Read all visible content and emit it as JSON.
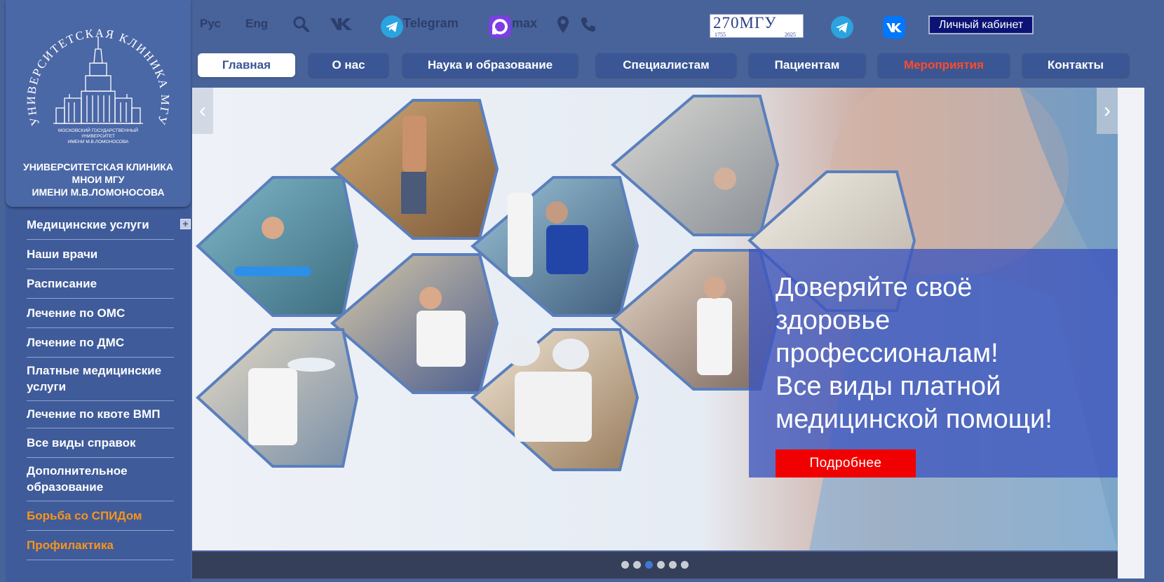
{
  "brand": {
    "logo_arc_text": "УНИВЕРСИТЕТСКАЯ КЛИНИКА МГУ",
    "logo_small_text": [
      "МОСКОВСКИЙ ГОСУДАРСТВЕННЫЙ",
      "УНИВЕРСИТЕТ",
      "ИМЕНИ М.В.ЛОМОНОСОВА"
    ],
    "name": "УНИВЕРСИТЕТСКАЯ КЛИНИКА\nМНОИ МГУ\nИМЕНИ М.В.ЛОМОНОСОВА"
  },
  "sidebar": {
    "items": [
      {
        "label": "Медицинские услуги",
        "expand": "+"
      },
      {
        "label": "Наши врачи"
      },
      {
        "label": "Расписание"
      },
      {
        "label": "Лечение по ОМС"
      },
      {
        "label": "Лечение по ДМС"
      },
      {
        "label": "Платные медицинские услуги"
      },
      {
        "label": "Лечение по квоте ВМП"
      },
      {
        "label": "Все виды справок"
      },
      {
        "label": "Дополнительное образование"
      },
      {
        "label": "Борьба со СПИДом"
      },
      {
        "label": "Профилактика"
      }
    ]
  },
  "topbar": {
    "lang_ru": "Рус",
    "lang_en": "Eng",
    "telegram_label": "Telegram",
    "max_label": "max",
    "badge": {
      "main": "270МГУ",
      "year_from": "1755",
      "year_to": "2025"
    },
    "cabinet_label": "Личный кабинет"
  },
  "nav": {
    "items": [
      {
        "label": "Главная"
      },
      {
        "label": "О нас"
      },
      {
        "label": "Наука и образование"
      },
      {
        "label": "Специалистам"
      },
      {
        "label": "Пациентам"
      },
      {
        "label": "Мероприятия"
      },
      {
        "label": "Контакты"
      }
    ]
  },
  "slider": {
    "prev_symbol": "‹",
    "next_symbol": "›",
    "headline": "Доверяйте своё\nздоровье\nпрофессионалам!\nВсе виды платной\nмедицинской помощи!",
    "cta_label": "Подробнее",
    "slide_count": 6,
    "active_slide": 3
  },
  "colors": {
    "accent_orange": "#f7941d",
    "events_red": "#ff4b2b",
    "cta_red": "#f00000",
    "cabinet_navy": "#0b1475"
  }
}
